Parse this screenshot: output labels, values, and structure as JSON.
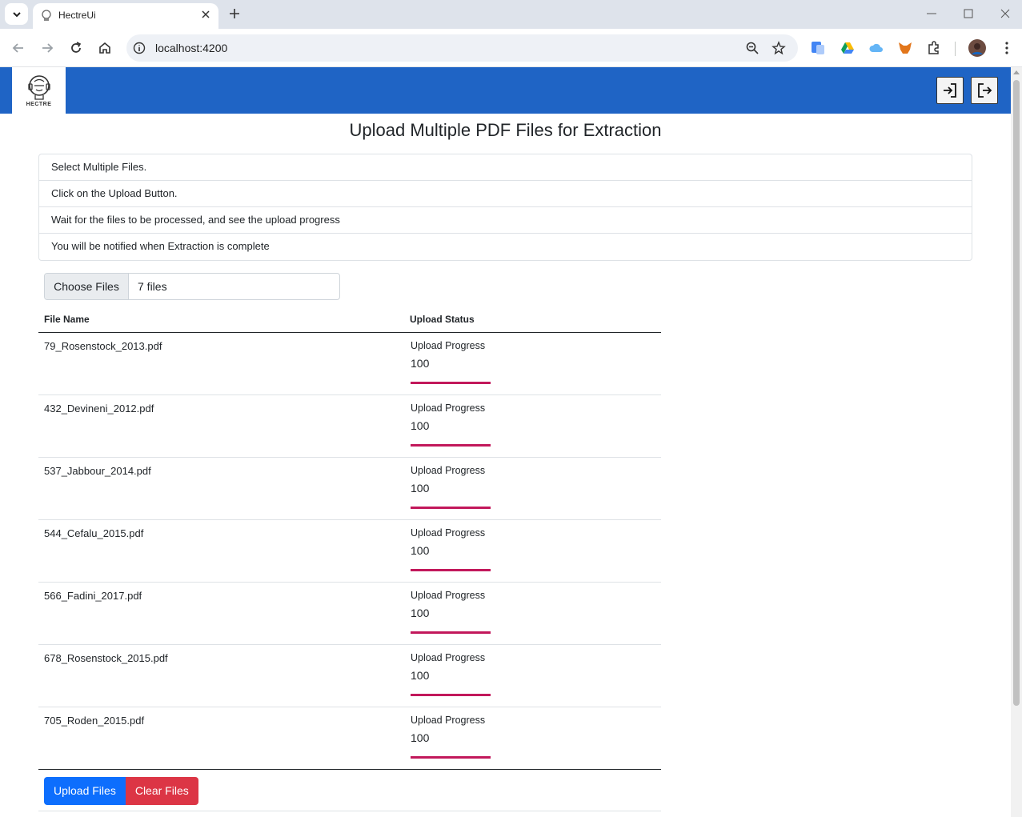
{
  "browser": {
    "tab_title": "HectreUi",
    "url": "localhost:4200"
  },
  "app": {
    "logo_text": "HECTRE",
    "page_title": "Upload Multiple PDF Files for Extraction",
    "instructions": [
      "Select Multiple Files.",
      "Click on the Upload Button.",
      "Wait for the files to be processed, and see the upload progress",
      "You will be notified when Extraction is complete"
    ],
    "file_input": {
      "choose_label": "Choose Files",
      "selected_text": "7 files"
    },
    "table": {
      "headers": [
        "File Name",
        "Upload Status"
      ],
      "rows": [
        {
          "file": "79_Rosenstock_2013.pdf",
          "status_label": "Upload Progress",
          "progress": "100"
        },
        {
          "file": "432_Devineni_2012.pdf",
          "status_label": "Upload Progress",
          "progress": "100"
        },
        {
          "file": "537_Jabbour_2014.pdf",
          "status_label": "Upload Progress",
          "progress": "100"
        },
        {
          "file": "544_Cefalu_2015.pdf",
          "status_label": "Upload Progress",
          "progress": "100"
        },
        {
          "file": "566_Fadini_2017.pdf",
          "status_label": "Upload Progress",
          "progress": "100"
        },
        {
          "file": "678_Rosenstock_2015.pdf",
          "status_label": "Upload Progress",
          "progress": "100"
        },
        {
          "file": "705_Roden_2015.pdf",
          "status_label": "Upload Progress",
          "progress": "100"
        }
      ]
    },
    "buttons": {
      "upload": "Upload Files",
      "clear": "Clear Files"
    }
  },
  "colors": {
    "appbar": "#1f64c5",
    "progress": "#c2185b",
    "primary": "#0d6efd",
    "danger": "#dc3545"
  },
  "icons": {
    "header_left": "login-icon",
    "header_right": "logout-icon"
  }
}
